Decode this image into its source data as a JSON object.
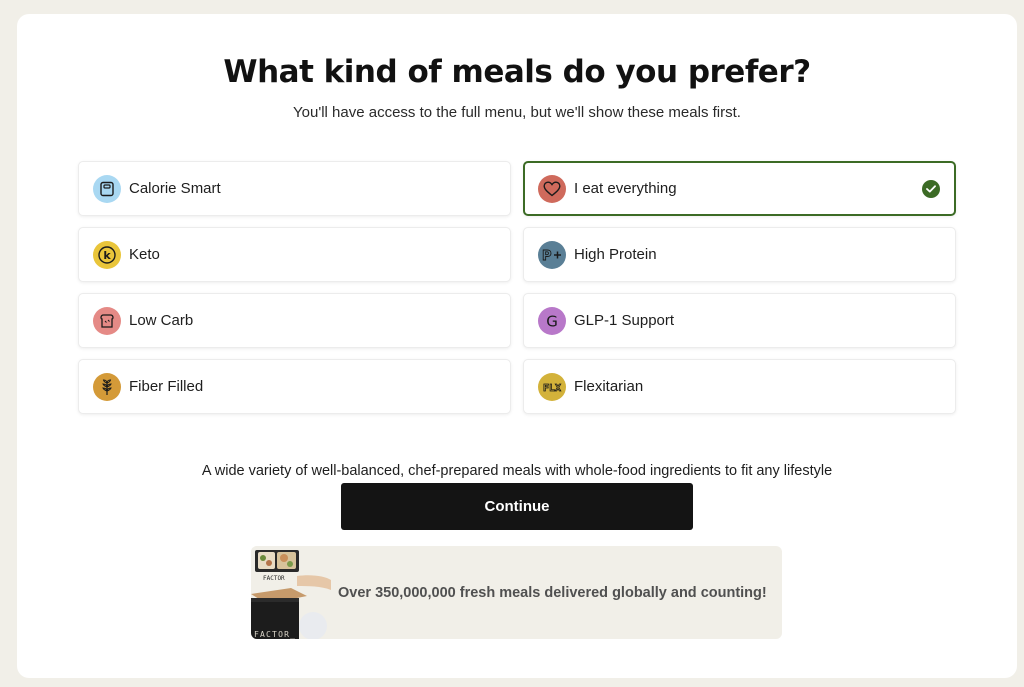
{
  "heading": {
    "title": "What kind of meals do you prefer?",
    "subtitle": "You'll have access to the full menu, but we'll show these meals first."
  },
  "options": [
    {
      "label": "Calorie Smart",
      "icon": "scale-icon",
      "color": "#a9d8f2",
      "selected": false
    },
    {
      "label": "I eat everything",
      "icon": "heart-icon",
      "color": "#cf6a5c",
      "selected": true
    },
    {
      "label": "Keto",
      "icon": "keto-k-icon",
      "color": "#e9c53a",
      "selected": false
    },
    {
      "label": "High Protein",
      "icon": "protein-plus-icon",
      "color": "#5a7f96",
      "selected": false
    },
    {
      "label": "Low Carb",
      "icon": "bread-icon",
      "color": "#e58a86",
      "selected": false
    },
    {
      "label": "GLP-1 Support",
      "icon": "glp-g-icon",
      "color": "#b878c9",
      "selected": false
    },
    {
      "label": "Fiber Filled",
      "icon": "wheat-icon",
      "color": "#d49a38",
      "selected": false
    },
    {
      "label": "Flexitarian",
      "icon": "flx-icon",
      "color": "#d3b23a",
      "selected": false
    }
  ],
  "description": "A wide variety of well-balanced, chef-prepared meals with whole-food ingredients to fit any lifestyle",
  "continue_label": "Continue",
  "promo": {
    "text": "Over 350,000,000 fresh meals delivered globally and counting!",
    "box_label": "FACTOR_",
    "box_label_small": "FACTOR"
  },
  "colors": {
    "selected_border": "#3c6b25",
    "button_bg": "#141414",
    "page_bg": "#f1efe8"
  }
}
